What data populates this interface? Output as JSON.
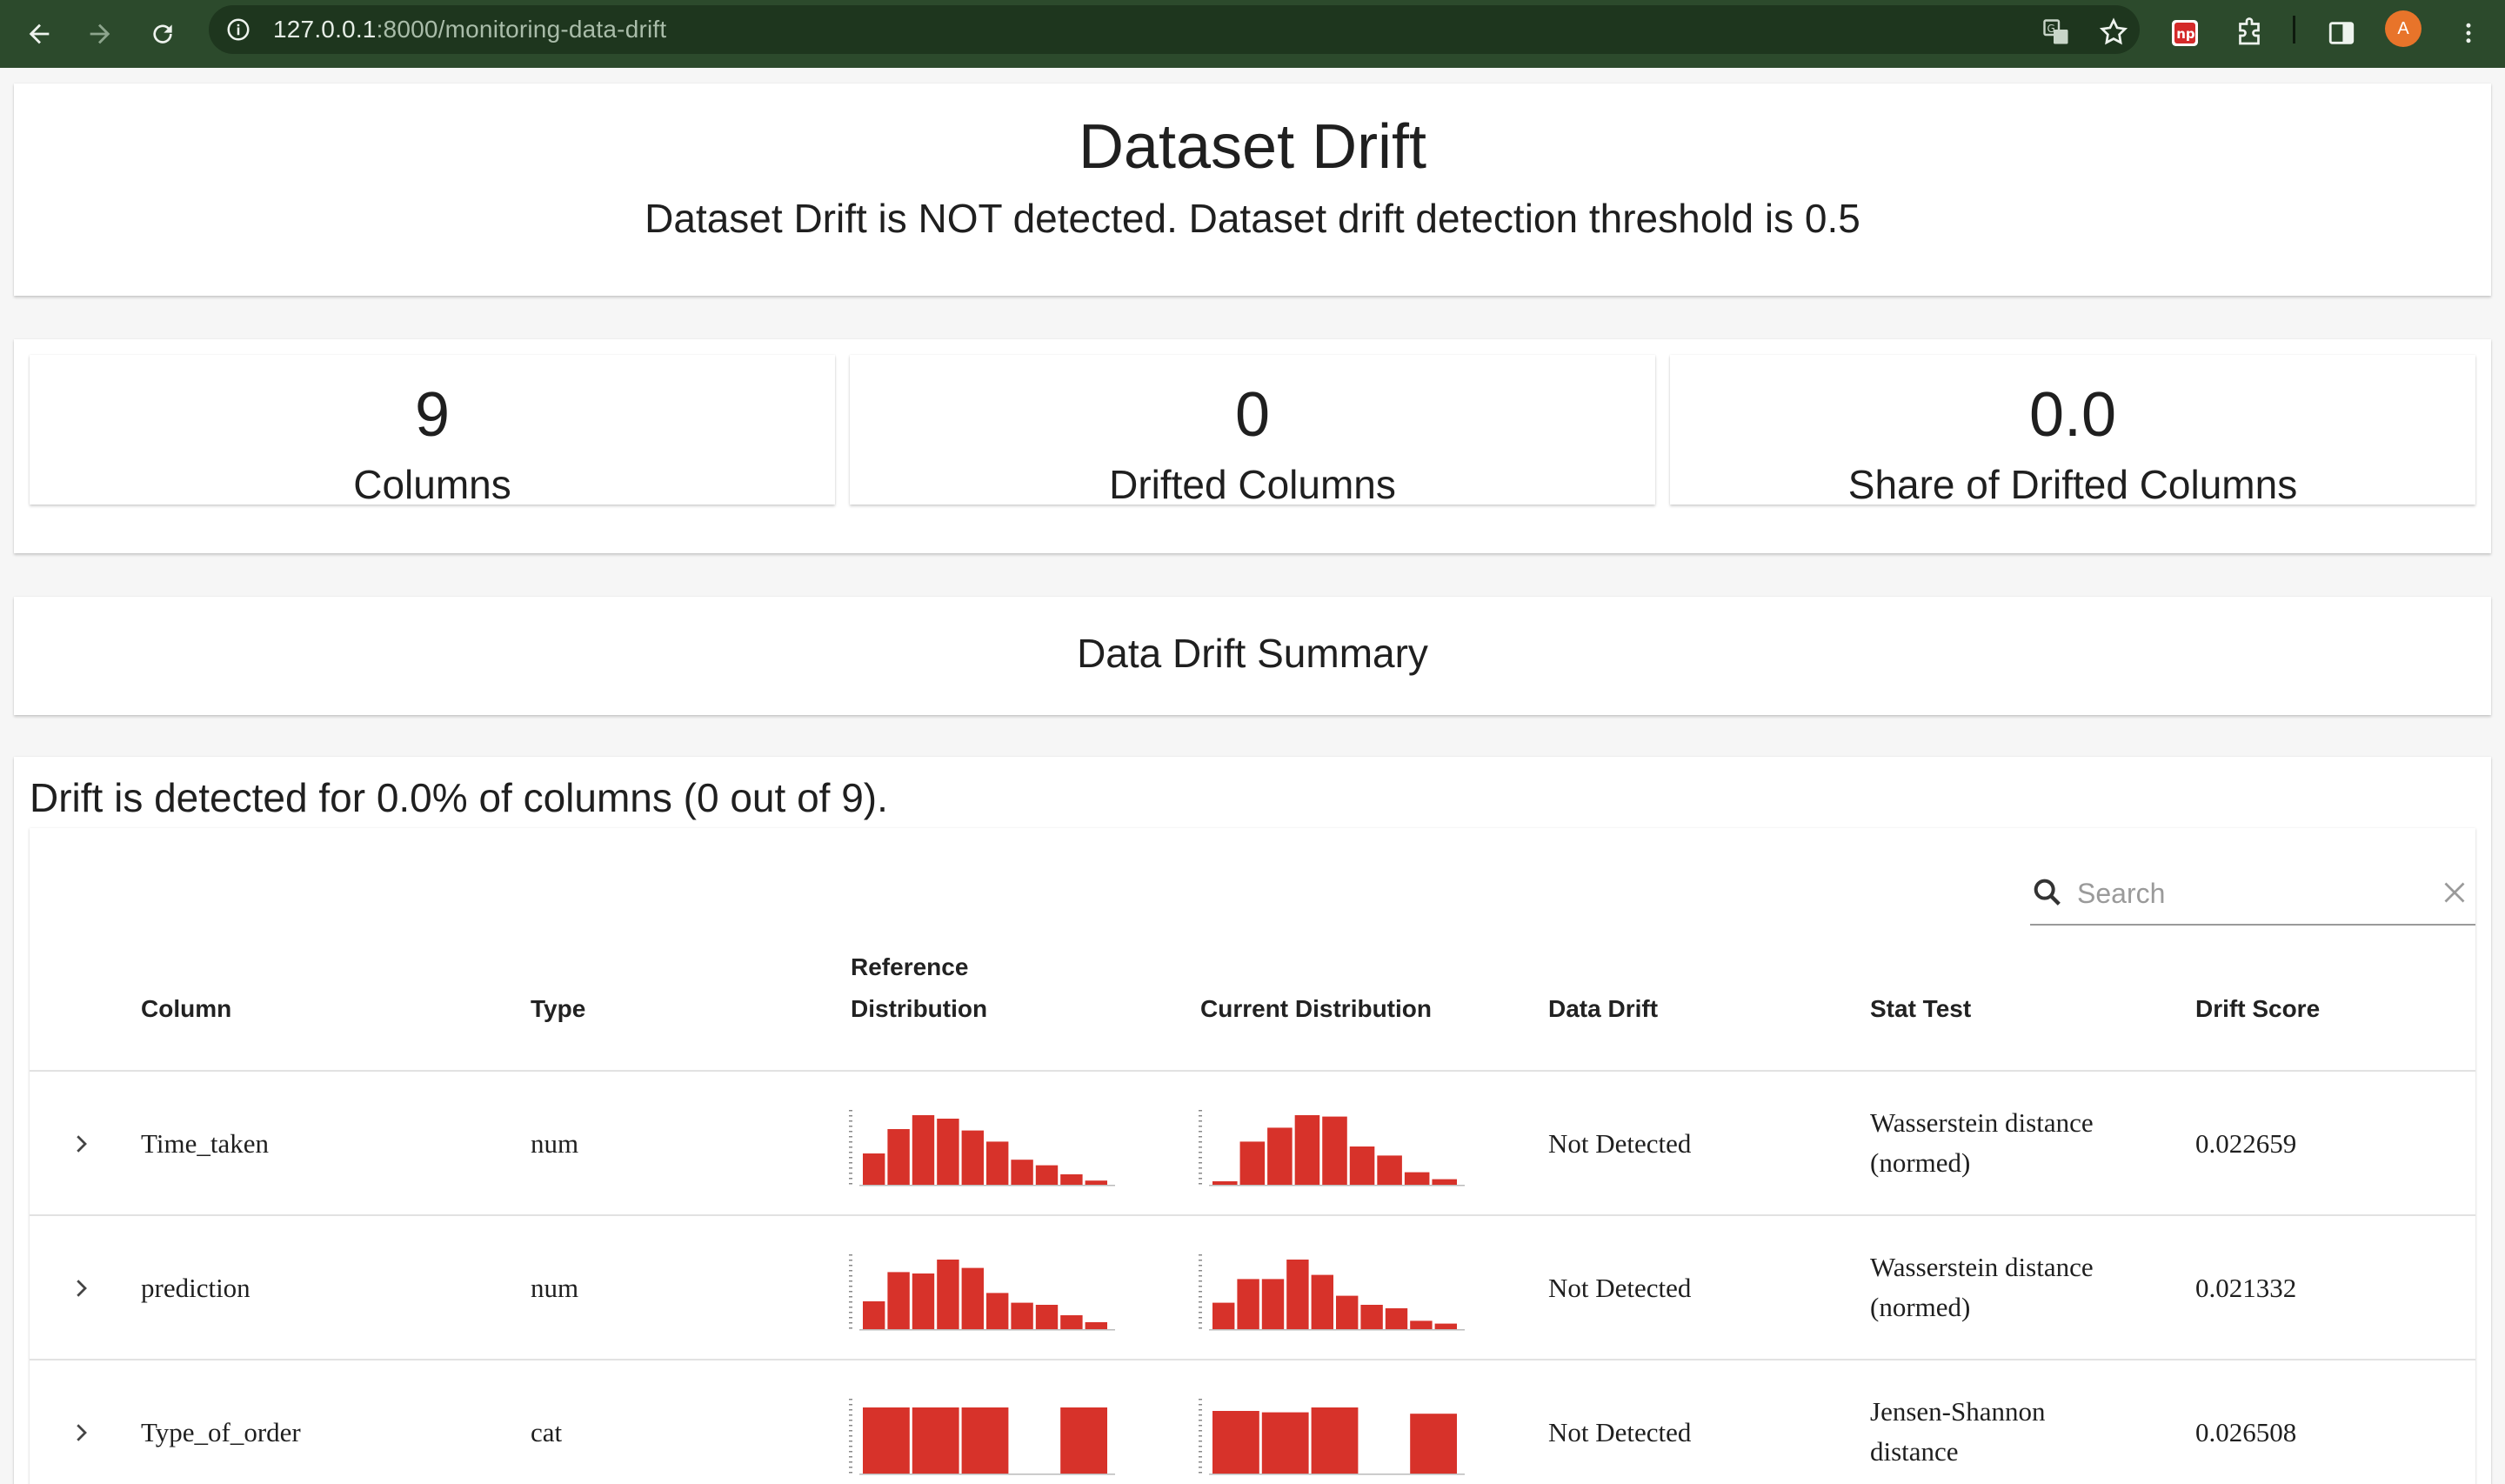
{
  "browser": {
    "url_host": "127.0.0.1",
    "url_path": ":8000/monitoring-data-drift",
    "avatar_letter": "A"
  },
  "header": {
    "title": "Dataset Drift",
    "subtitle": "Dataset Drift is NOT detected. Dataset drift detection threshold is 0.5"
  },
  "counters": [
    {
      "value": "9",
      "label": "Columns"
    },
    {
      "value": "0",
      "label": "Drifted Columns"
    },
    {
      "value": "0.0",
      "label": "Share of Drifted Columns"
    }
  ],
  "summary": {
    "title": "Data Drift Summary"
  },
  "table": {
    "description": "Drift is detected for 0.0% of columns (0 out of 9).",
    "search_placeholder": "Search",
    "headers": {
      "column": "Column",
      "type": "Type",
      "reference_1": "Reference",
      "reference_2": "Distribution",
      "current": "Current Distribution",
      "drift": "Data Drift",
      "stat_test": "Stat Test",
      "score": "Drift Score"
    },
    "rows": [
      {
        "column": "Time_taken",
        "type": "num",
        "drift": "Not Detected",
        "stat_1": "Wasserstein distance",
        "stat_2": "(normed)",
        "score": "0.022659",
        "ref_hist": [
          0.45,
          0.8,
          1.0,
          0.95,
          0.78,
          0.62,
          0.36,
          0.28,
          0.15,
          0.06
        ],
        "cur_hist": [
          0.05,
          0.62,
          0.82,
          1.0,
          0.98,
          0.55,
          0.42,
          0.18,
          0.08
        ]
      },
      {
        "column": "prediction",
        "type": "num",
        "drift": "Not Detected",
        "stat_1": "Wasserstein distance",
        "stat_2": "(normed)",
        "score": "0.021332",
        "ref_hist": [
          0.4,
          0.82,
          0.8,
          1.0,
          0.88,
          0.52,
          0.38,
          0.35,
          0.2,
          0.1
        ],
        "cur_hist": [
          0.38,
          0.72,
          0.72,
          1.0,
          0.78,
          0.48,
          0.35,
          0.3,
          0.12,
          0.08
        ]
      },
      {
        "column": "Type_of_order",
        "type": "cat",
        "drift": "Not Detected",
        "stat_1": "Jensen-Shannon",
        "stat_2": "distance",
        "score": "0.026508",
        "ref_hist": [
          0.95,
          0.95,
          0.95,
          0,
          0.95
        ],
        "cur_hist": [
          0.9,
          0.88,
          0.95,
          0,
          0.86
        ]
      }
    ]
  },
  "colors": {
    "bar": "#d7322a",
    "chrome": "#2c4a2c"
  }
}
